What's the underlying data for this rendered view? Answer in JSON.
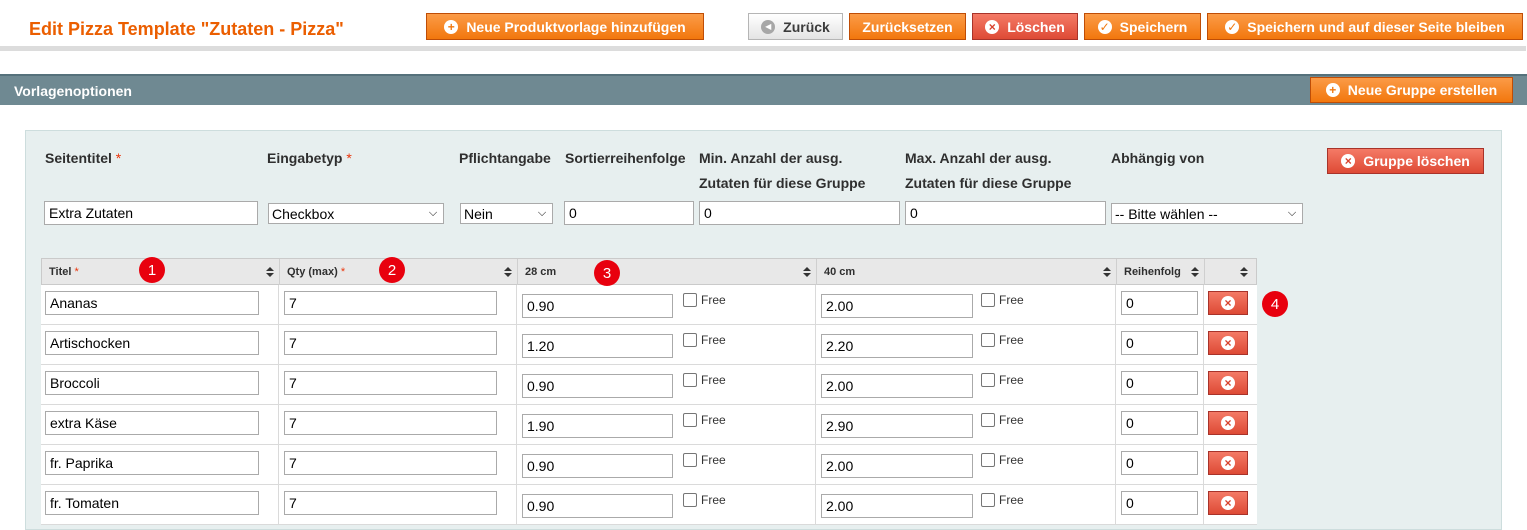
{
  "header": {
    "title": "Edit Pizza Template \"Zutaten - Pizza\"",
    "add_template_label": "Neue Produktvorlage hinzufügen",
    "back_label": "Zurück",
    "reset_label": "Zurücksetzen",
    "delete_label": "Löschen",
    "save_label": "Speichern",
    "save_stay_label": "Speichern und auf dieser Seite bleiben"
  },
  "section": {
    "title": "Vorlagenoptionen",
    "new_group_label": "Neue Gruppe erstellen"
  },
  "group": {
    "labels": {
      "page_title": "Seitentitel",
      "input_type": "Eingabetyp",
      "required": "Pflichtangabe",
      "sort_order": "Sortierreihenfolge",
      "min": "Min. Anzahl der ausg. Zutaten für diese Gruppe",
      "max": "Max. Anzahl der ausg. Zutaten für diese Gruppe",
      "depends": "Abhängig von"
    },
    "required_mark": "*",
    "values": {
      "page_title": "Extra Zutaten",
      "input_type": "Checkbox",
      "required": "Nein",
      "sort_order": "0",
      "min": "0",
      "max": "0",
      "depends": "-- Bitte wählen --"
    },
    "delete_group_label": "Gruppe löschen"
  },
  "table": {
    "columns": {
      "title": "Titel",
      "qty": "Qty (max)",
      "size1": "28 cm",
      "size2": "40 cm",
      "order": "Reihenfolg"
    },
    "free_label": "Free",
    "rows": [
      {
        "title": "Ananas",
        "qty": "7",
        "p1": "0.90",
        "p2": "2.00",
        "order": "0"
      },
      {
        "title": "Artischocken",
        "qty": "7",
        "p1": "1.20",
        "p2": "2.20",
        "order": "0"
      },
      {
        "title": "Broccoli",
        "qty": "7",
        "p1": "0.90",
        "p2": "2.00",
        "order": "0"
      },
      {
        "title": "extra Käse",
        "qty": "7",
        "p1": "1.90",
        "p2": "2.90",
        "order": "0"
      },
      {
        "title": "fr. Paprika",
        "qty": "7",
        "p1": "0.90",
        "p2": "2.00",
        "order": "0"
      },
      {
        "title": "fr. Tomaten",
        "qty": "7",
        "p1": "0.90",
        "p2": "2.00",
        "order": "0"
      }
    ]
  },
  "markers": [
    "1",
    "2",
    "3",
    "4"
  ],
  "icons": {
    "plus": "+",
    "x": "×",
    "check": "✓",
    "back": "◀"
  },
  "colors": {
    "accent": "#eb5e00",
    "orange_button": "#f2770d",
    "red_button": "#de4a35",
    "section_bar": "#6f8992",
    "panel": "#e7efef",
    "marker": "#e8000e"
  }
}
